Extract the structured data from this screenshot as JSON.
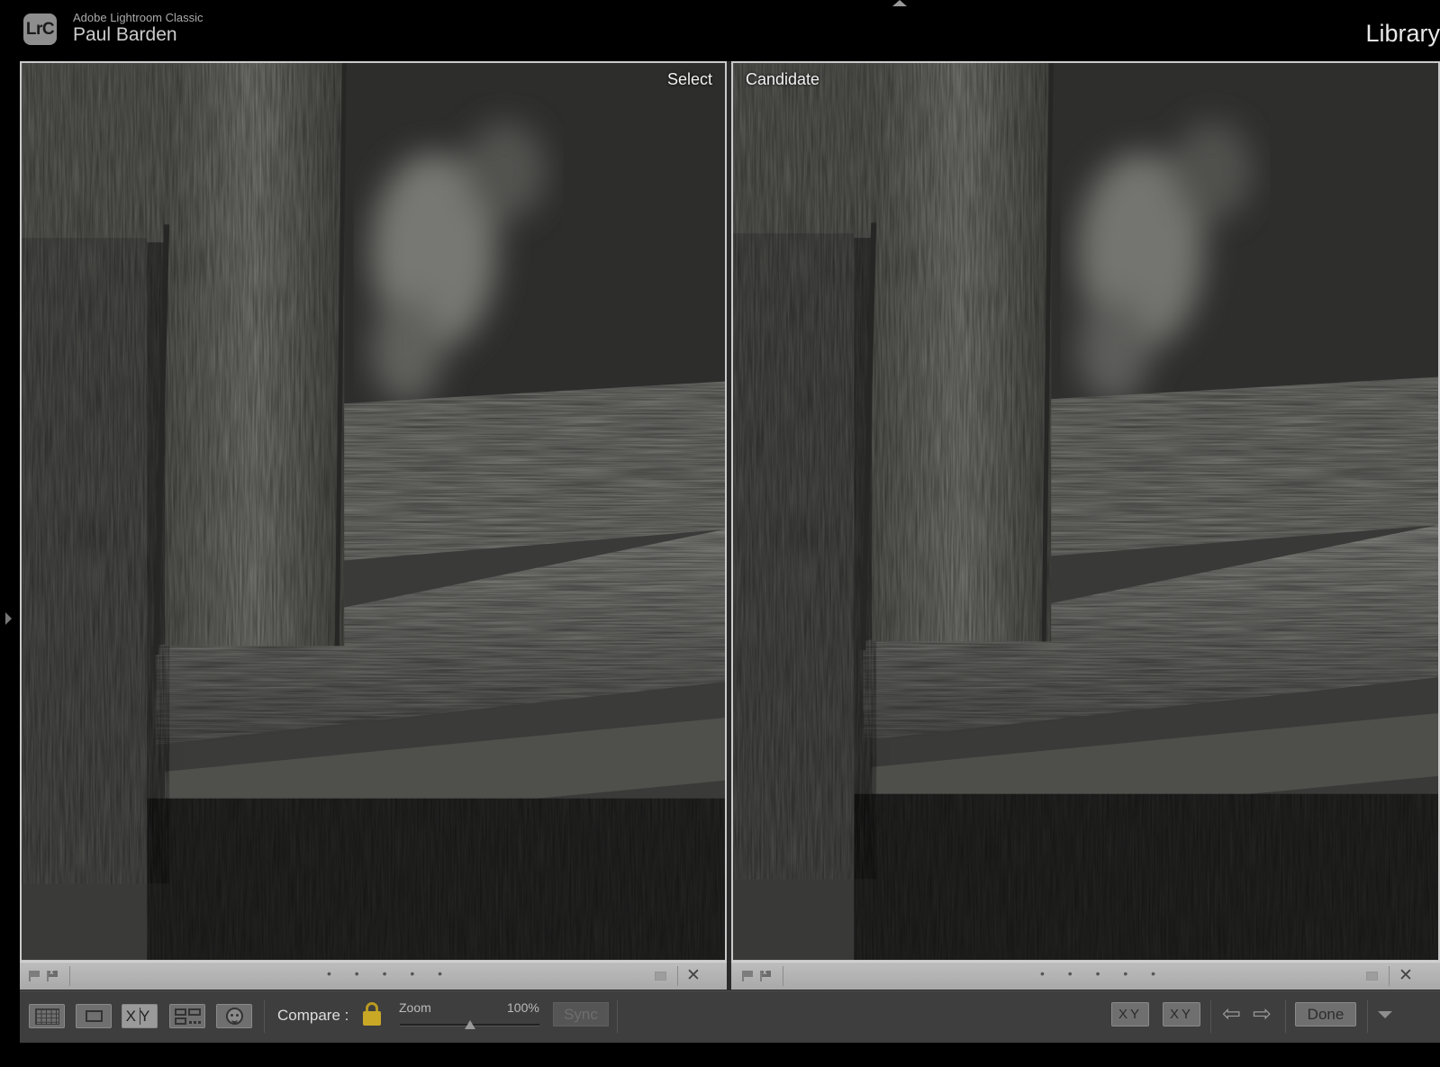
{
  "header": {
    "app_badge": "LrC",
    "app_name": "Adobe Lightroom Classic",
    "user_name": "Paul Barden",
    "module": "Library"
  },
  "compare": {
    "panes": [
      {
        "label": "Select",
        "stars": "• • • • •"
      },
      {
        "label": "Candidate",
        "stars": "• • • • •"
      }
    ],
    "close_glyph": "✕"
  },
  "toolbar": {
    "view_modes": [
      {
        "name": "grid-view",
        "icon": "grid-icon"
      },
      {
        "name": "loupe-view",
        "icon": "loupe-icon"
      },
      {
        "name": "compare-view",
        "icon": "xy-compare-icon",
        "label": "XY",
        "active": true
      },
      {
        "name": "survey-view",
        "icon": "survey-icon"
      },
      {
        "name": "people-view",
        "icon": "face-icon"
      }
    ],
    "compare_label": "Compare :",
    "zoom_label": "Zoom",
    "zoom_value": "100%",
    "zoom_fraction": 0.5,
    "sync_label": "Sync",
    "swap_label": "XY",
    "make_select_label": "XY",
    "prev_arrow": "⇦",
    "next_arrow": "⇨",
    "done_label": "Done"
  },
  "colors": {
    "lock": "#c9a826",
    "frame": "#c9c9c9",
    "toolbar": "#3e3e3e"
  }
}
